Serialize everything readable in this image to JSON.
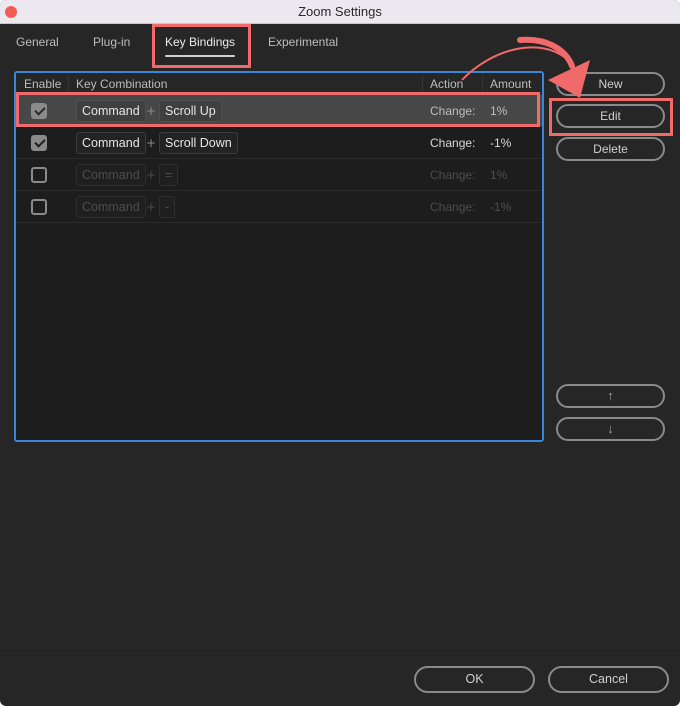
{
  "window": {
    "title": "Zoom Settings"
  },
  "tabs": [
    {
      "label": "General",
      "active": false
    },
    {
      "label": "Plug-in",
      "active": false
    },
    {
      "label": "Key Bindings",
      "active": true
    },
    {
      "label": "Experimental",
      "active": false
    }
  ],
  "table": {
    "headers": {
      "enable": "Enable",
      "key_combination": "Key Combination",
      "action": "Action",
      "amount": "Amount"
    },
    "rows": [
      {
        "enabled": true,
        "modifier": "Command",
        "plus": "+",
        "key": "Scroll Up",
        "action": "Change:",
        "amount": "1%",
        "selected": true
      },
      {
        "enabled": true,
        "modifier": "Command",
        "plus": "+",
        "key": "Scroll Down",
        "action": "Change:",
        "amount": "-1%",
        "selected": false
      },
      {
        "enabled": false,
        "modifier": "Command",
        "plus": "+",
        "key": "=",
        "action": "Change:",
        "amount": "1%",
        "selected": false
      },
      {
        "enabled": false,
        "modifier": "Command",
        "plus": "+",
        "key": "-",
        "action": "Change:",
        "amount": "-1%",
        "selected": false
      }
    ]
  },
  "side_buttons": {
    "new": "New",
    "edit": "Edit",
    "delete": "Delete",
    "move_up": "↑",
    "move_down": "↓"
  },
  "footer": {
    "ok": "OK",
    "cancel": "Cancel"
  },
  "colors": {
    "annotation": "#f06a6a",
    "focus_border": "#3a86d6",
    "close_button": "#f25c54"
  }
}
